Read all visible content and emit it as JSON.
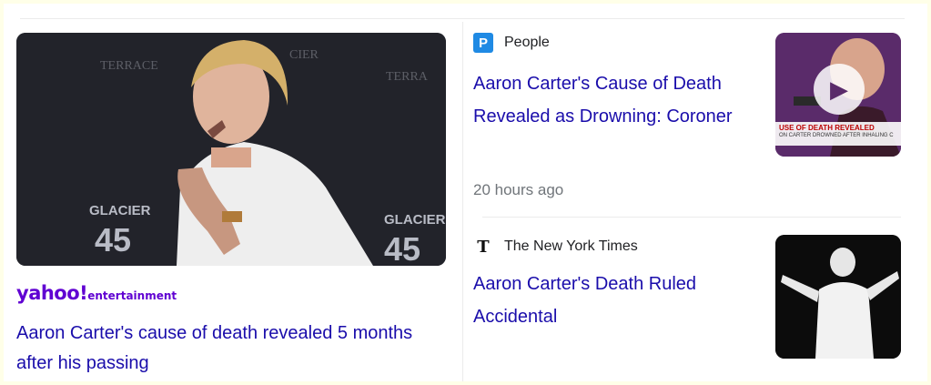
{
  "left_story": {
    "source": "yahoo!",
    "source_sub": "entertainment",
    "headline": "Aaron Carter's cause of death revealed 5 months after his passing",
    "image_texts": [
      "GLACIER",
      "45"
    ]
  },
  "right_stories": [
    {
      "source": "People",
      "source_icon": "P",
      "headline": "Aaron Carter's Cause of Death Revealed as Drowning: Coroner",
      "time": "20 hours ago",
      "thumb_banner": "USE OF DEATH REVEALED",
      "thumb_banner_sub": "ON CARTER DROWNED AFTER INHALING C"
    },
    {
      "source": "The New York Times",
      "source_icon": "T",
      "headline": "Aaron Carter's Death Ruled Accidental"
    }
  ],
  "colors": {
    "headline": "#1a0dab",
    "yahoo_purple": "#6001d2",
    "people_blue": "#1f8ae4",
    "meta_gray": "#70757a"
  }
}
